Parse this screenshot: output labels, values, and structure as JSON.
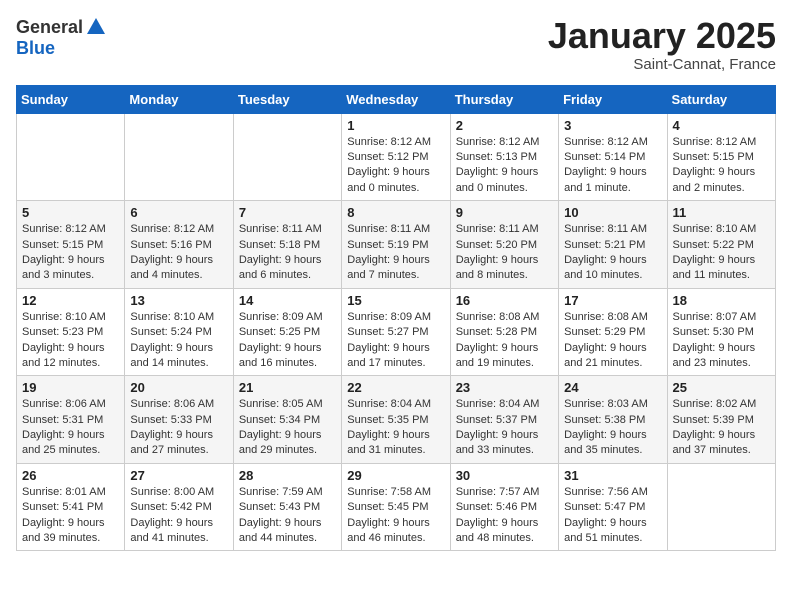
{
  "header": {
    "logo_general": "General",
    "logo_blue": "Blue",
    "month_title": "January 2025",
    "location": "Saint-Cannat, France"
  },
  "weekdays": [
    "Sunday",
    "Monday",
    "Tuesday",
    "Wednesday",
    "Thursday",
    "Friday",
    "Saturday"
  ],
  "weeks": [
    [
      {
        "num": "",
        "info": ""
      },
      {
        "num": "",
        "info": ""
      },
      {
        "num": "",
        "info": ""
      },
      {
        "num": "1",
        "info": "Sunrise: 8:12 AM\nSunset: 5:12 PM\nDaylight: 9 hours\nand 0 minutes."
      },
      {
        "num": "2",
        "info": "Sunrise: 8:12 AM\nSunset: 5:13 PM\nDaylight: 9 hours\nand 0 minutes."
      },
      {
        "num": "3",
        "info": "Sunrise: 8:12 AM\nSunset: 5:14 PM\nDaylight: 9 hours\nand 1 minute."
      },
      {
        "num": "4",
        "info": "Sunrise: 8:12 AM\nSunset: 5:15 PM\nDaylight: 9 hours\nand 2 minutes."
      }
    ],
    [
      {
        "num": "5",
        "info": "Sunrise: 8:12 AM\nSunset: 5:15 PM\nDaylight: 9 hours\nand 3 minutes."
      },
      {
        "num": "6",
        "info": "Sunrise: 8:12 AM\nSunset: 5:16 PM\nDaylight: 9 hours\nand 4 minutes."
      },
      {
        "num": "7",
        "info": "Sunrise: 8:11 AM\nSunset: 5:18 PM\nDaylight: 9 hours\nand 6 minutes."
      },
      {
        "num": "8",
        "info": "Sunrise: 8:11 AM\nSunset: 5:19 PM\nDaylight: 9 hours\nand 7 minutes."
      },
      {
        "num": "9",
        "info": "Sunrise: 8:11 AM\nSunset: 5:20 PM\nDaylight: 9 hours\nand 8 minutes."
      },
      {
        "num": "10",
        "info": "Sunrise: 8:11 AM\nSunset: 5:21 PM\nDaylight: 9 hours\nand 10 minutes."
      },
      {
        "num": "11",
        "info": "Sunrise: 8:10 AM\nSunset: 5:22 PM\nDaylight: 9 hours\nand 11 minutes."
      }
    ],
    [
      {
        "num": "12",
        "info": "Sunrise: 8:10 AM\nSunset: 5:23 PM\nDaylight: 9 hours\nand 12 minutes."
      },
      {
        "num": "13",
        "info": "Sunrise: 8:10 AM\nSunset: 5:24 PM\nDaylight: 9 hours\nand 14 minutes."
      },
      {
        "num": "14",
        "info": "Sunrise: 8:09 AM\nSunset: 5:25 PM\nDaylight: 9 hours\nand 16 minutes."
      },
      {
        "num": "15",
        "info": "Sunrise: 8:09 AM\nSunset: 5:27 PM\nDaylight: 9 hours\nand 17 minutes."
      },
      {
        "num": "16",
        "info": "Sunrise: 8:08 AM\nSunset: 5:28 PM\nDaylight: 9 hours\nand 19 minutes."
      },
      {
        "num": "17",
        "info": "Sunrise: 8:08 AM\nSunset: 5:29 PM\nDaylight: 9 hours\nand 21 minutes."
      },
      {
        "num": "18",
        "info": "Sunrise: 8:07 AM\nSunset: 5:30 PM\nDaylight: 9 hours\nand 23 minutes."
      }
    ],
    [
      {
        "num": "19",
        "info": "Sunrise: 8:06 AM\nSunset: 5:31 PM\nDaylight: 9 hours\nand 25 minutes."
      },
      {
        "num": "20",
        "info": "Sunrise: 8:06 AM\nSunset: 5:33 PM\nDaylight: 9 hours\nand 27 minutes."
      },
      {
        "num": "21",
        "info": "Sunrise: 8:05 AM\nSunset: 5:34 PM\nDaylight: 9 hours\nand 29 minutes."
      },
      {
        "num": "22",
        "info": "Sunrise: 8:04 AM\nSunset: 5:35 PM\nDaylight: 9 hours\nand 31 minutes."
      },
      {
        "num": "23",
        "info": "Sunrise: 8:04 AM\nSunset: 5:37 PM\nDaylight: 9 hours\nand 33 minutes."
      },
      {
        "num": "24",
        "info": "Sunrise: 8:03 AM\nSunset: 5:38 PM\nDaylight: 9 hours\nand 35 minutes."
      },
      {
        "num": "25",
        "info": "Sunrise: 8:02 AM\nSunset: 5:39 PM\nDaylight: 9 hours\nand 37 minutes."
      }
    ],
    [
      {
        "num": "26",
        "info": "Sunrise: 8:01 AM\nSunset: 5:41 PM\nDaylight: 9 hours\nand 39 minutes."
      },
      {
        "num": "27",
        "info": "Sunrise: 8:00 AM\nSunset: 5:42 PM\nDaylight: 9 hours\nand 41 minutes."
      },
      {
        "num": "28",
        "info": "Sunrise: 7:59 AM\nSunset: 5:43 PM\nDaylight: 9 hours\nand 44 minutes."
      },
      {
        "num": "29",
        "info": "Sunrise: 7:58 AM\nSunset: 5:45 PM\nDaylight: 9 hours\nand 46 minutes."
      },
      {
        "num": "30",
        "info": "Sunrise: 7:57 AM\nSunset: 5:46 PM\nDaylight: 9 hours\nand 48 minutes."
      },
      {
        "num": "31",
        "info": "Sunrise: 7:56 AM\nSunset: 5:47 PM\nDaylight: 9 hours\nand 51 minutes."
      },
      {
        "num": "",
        "info": ""
      }
    ]
  ]
}
